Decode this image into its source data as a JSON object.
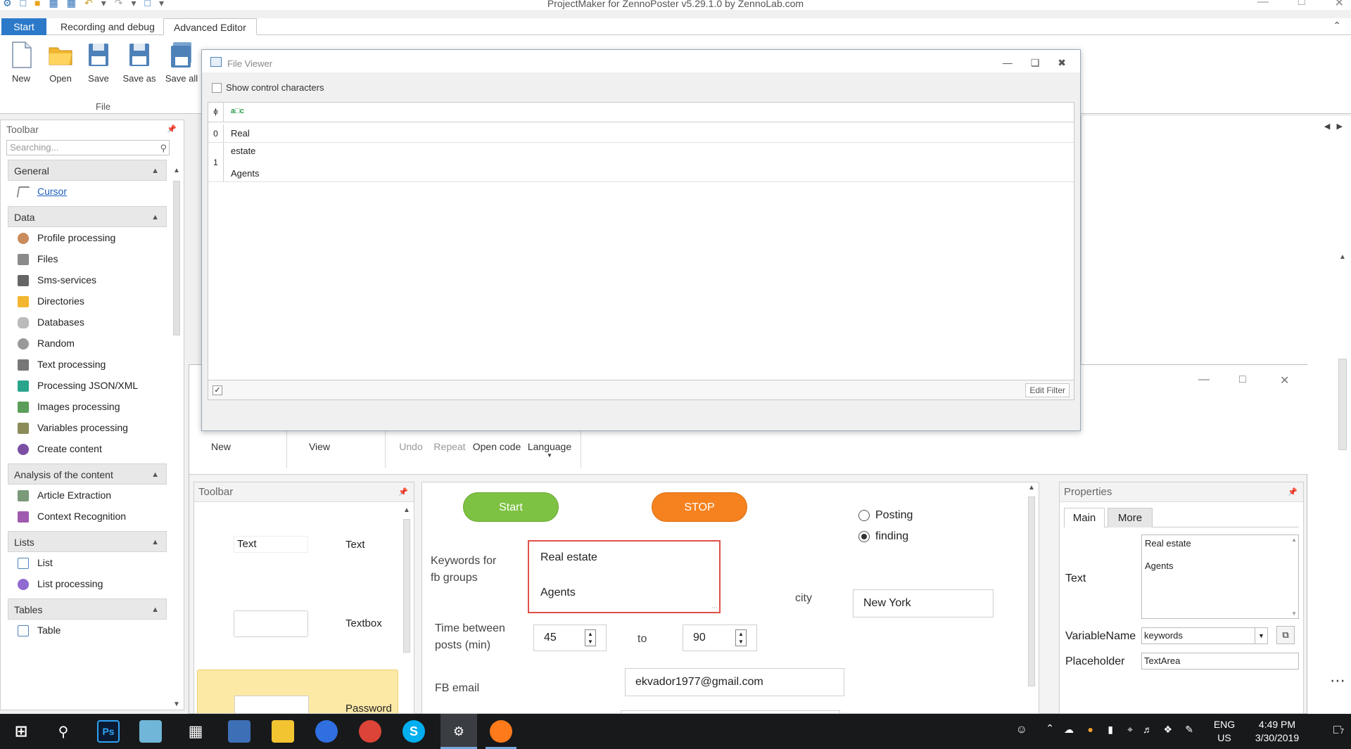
{
  "app": {
    "title": "ProjectMaker for ZennoPoster v5.29.1.0 by ZennoLab.com"
  },
  "ribbon": {
    "tabs": [
      {
        "label": "Start"
      },
      {
        "label": "Recording and debug"
      },
      {
        "label": "Advanced Editor"
      }
    ],
    "buttons": [
      {
        "label": "New"
      },
      {
        "label": "Open"
      },
      {
        "label": "Save"
      },
      {
        "label": "Save as"
      },
      {
        "label": "Save all"
      }
    ],
    "group_label": "File"
  },
  "left_toolbar": {
    "title": "Toolbar",
    "search_placeholder": "Searching...",
    "categories": {
      "general": {
        "label": "General",
        "items": [
          "Cursor"
        ]
      },
      "data": {
        "label": "Data",
        "items": [
          "Profile processing",
          "Files",
          "Sms-services",
          "Directories",
          "Databases",
          "Random",
          "Text processing",
          "Processing JSON/XML",
          "Images processing",
          "Variables processing",
          "Create content"
        ]
      },
      "analysis": {
        "label": "Analysis of the content",
        "items": [
          "Article Extraction",
          "Context Recognition"
        ]
      },
      "lists": {
        "label": "Lists",
        "items": [
          "List",
          "List processing"
        ]
      },
      "tables": {
        "label": "Tables",
        "items": [
          "Table"
        ]
      }
    }
  },
  "file_viewer": {
    "title": "File Viewer",
    "show_control_chars": "Show control characters",
    "filter_header": "a□c",
    "filter_icon": "ϕ",
    "rows": [
      {
        "index": "0",
        "lines": [
          "Real"
        ]
      },
      {
        "index": "1",
        "lines": [
          "estate",
          "Agents"
        ]
      }
    ],
    "footer_check": "✓",
    "edit_filter": "Edit Filter"
  },
  "designer": {
    "toolbar_buttons": {
      "new": "New",
      "view": "View",
      "undo": "Undo",
      "repeat": "Repeat",
      "open_code": "Open code",
      "language": "Language"
    },
    "toolbar_panel": {
      "title": "Toolbar",
      "items": [
        {
          "preview": "Text",
          "label": "Text"
        },
        {
          "preview": "",
          "label": "Textbox"
        },
        {
          "preview": "",
          "label": "Password"
        }
      ]
    },
    "canvas": {
      "start_button": "Start",
      "stop_button": "STOP",
      "radio_posting": "Posting",
      "radio_finding": "finding",
      "keywords_label": "Keywords for fb groups",
      "keywords_line1": "Real estate",
      "keywords_line2": "Agents",
      "city_label": "city",
      "city_value": "New York",
      "time_label": "Time between posts (min)",
      "time_from": "45",
      "to_label": "to",
      "time_to": "90",
      "email_label": "FB email",
      "email_value": "ekvador1977@gmail.com"
    },
    "properties": {
      "title": "Properties",
      "tab_main": "Main",
      "tab_more": "More",
      "text_label": "Text",
      "text_line1": "Real estate",
      "text_line2": "Agents",
      "varname_label": "VariableName",
      "varname_value": "keywords",
      "placeholder_label": "Placeholder",
      "placeholder_value": "TextArea"
    }
  },
  "taskbar": {
    "lang_top": "ENG",
    "lang_bottom": "US",
    "time": "4:49 PM",
    "date": "3/30/2019",
    "notifications": "7"
  },
  "colors": {
    "accent_blue": "#2c79c9",
    "start_green": "#7dc242",
    "stop_orange": "#f5821f",
    "keywords_border": "#e0504a"
  }
}
